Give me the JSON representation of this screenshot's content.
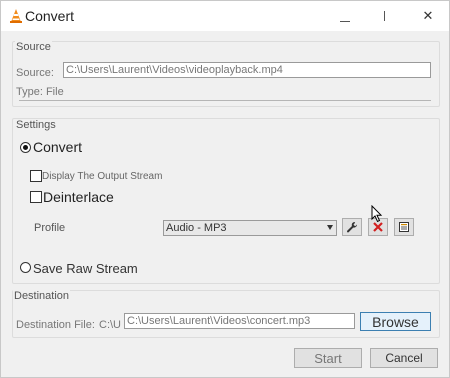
{
  "window": {
    "title": "Convert",
    "close_glyph": "✕",
    "app_icon": "vlc-cone-icon"
  },
  "source": {
    "legend": "Source",
    "source_label": "Source:",
    "source_value": "C:\\Users\\Laurent\\Videos\\videoplayback.mp4",
    "type_text": "Type: File"
  },
  "settings": {
    "legend": "Settings",
    "convert_label": "Convert",
    "display_output_label": "Display The Output Stream",
    "deinterlace_label": "Deinterlace",
    "profile_label": "Profile",
    "profile_selected": "Audio - MP3",
    "save_raw_label": "Save Raw Stream",
    "convert_checked": true,
    "display_output_checked": false,
    "deinterlace_checked": false,
    "save_raw_checked": false,
    "colors": {
      "delete_icon": "#d22020"
    }
  },
  "destination": {
    "legend": "Destination",
    "file_label": "Destination File:",
    "file_value": "C:\\Users\\Laurent\\Videos\\concert.mp3",
    "browse_label": "Browse"
  },
  "footer": {
    "start_label": "Start",
    "cancel_label": "Cancel"
  }
}
